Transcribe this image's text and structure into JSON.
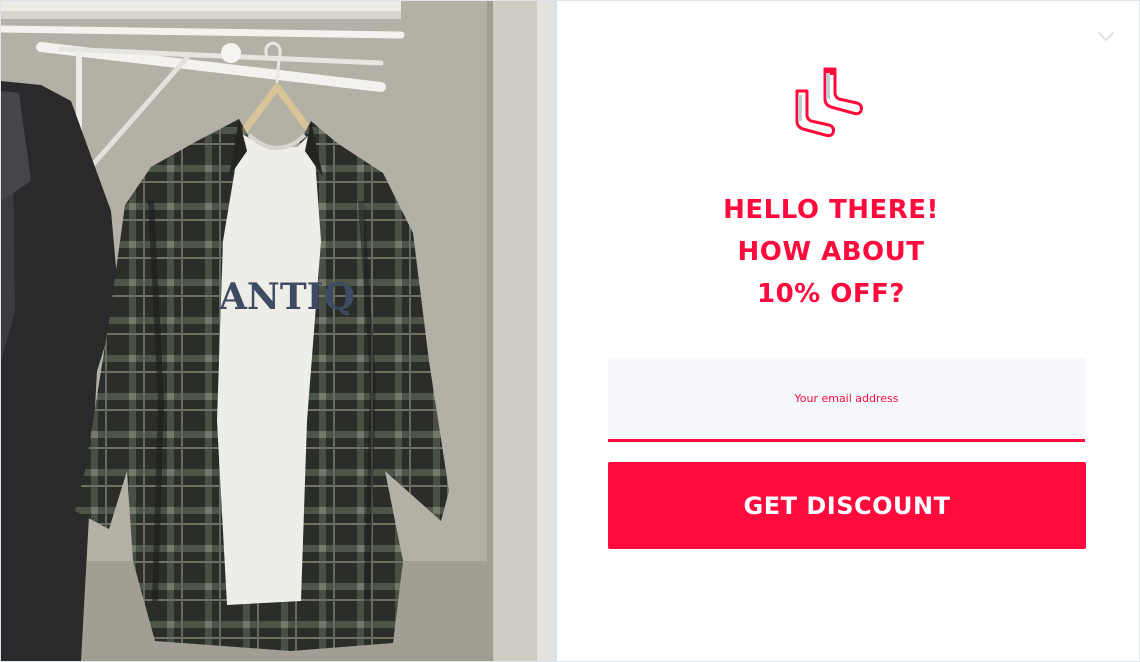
{
  "popup": {
    "photo_alt": "Plaid flannel shirt over a white graphic t-shirt hanging in a closet",
    "tshirt_print": "ANTIQ",
    "close_icon": "close-icon",
    "logo_icon": "socks-logo-icon",
    "headline": {
      "line1": "HELLO THERE!",
      "line2": "HOW ABOUT",
      "line3": "10% OFF?"
    },
    "email_field": {
      "placeholder": "Your email address",
      "value": ""
    },
    "cta_label": "GET DISCOUNT"
  },
  "colors": {
    "accent": "#ff0a3c",
    "input_bg": "#f6f8fb",
    "background": "#ffffff"
  }
}
